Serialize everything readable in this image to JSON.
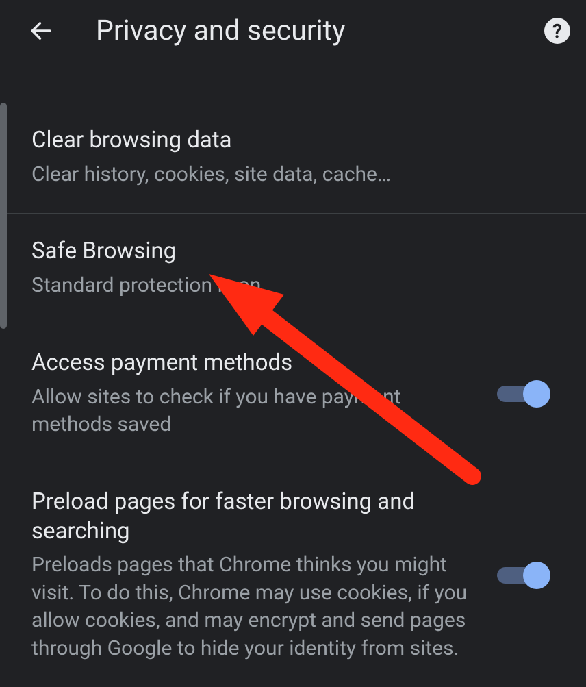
{
  "header": {
    "title": "Privacy and security"
  },
  "rows": {
    "clear": {
      "title": "Clear browsing data",
      "subtitle": "Clear history, cookies, site data, cache…"
    },
    "safeBrowsing": {
      "title": "Safe Browsing",
      "subtitle": "Standard protection is on"
    },
    "payment": {
      "title": "Access payment methods",
      "subtitle": "Allow sites to check if you have payment methods saved"
    },
    "preload": {
      "title": "Preload pages for faster browsing and searching",
      "subtitle": "Preloads pages that Chrome thinks you might visit. To do this, Chrome may use cookies, if you allow cookies, and may encrypt and send pages through Google to hide your identity from sites."
    }
  }
}
